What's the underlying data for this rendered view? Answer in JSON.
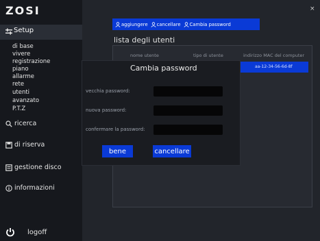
{
  "brand": "ZOSI",
  "sidebar": {
    "setup_label": "Setup",
    "sub_items": [
      "di base",
      "vivere",
      "registrazione",
      "piano",
      "allarme",
      "rete",
      "utenti",
      "avanzato",
      "P.T.Z"
    ],
    "ricerca": "ricerca",
    "di_riserva": "di riserva",
    "gestione_disco": "gestione disco",
    "informazioni": "informazioni",
    "logoff": "logoff"
  },
  "window": {
    "close": "×"
  },
  "toolbar": {
    "add": "aggiungere",
    "delete": "cancellare",
    "change_password": "Cambia password"
  },
  "user_list": {
    "title": "lista degli utenti",
    "columns": [
      "nome utente",
      "tipo di utente",
      "indirizzo MAC del computer"
    ],
    "selected_mac": "aa-12-34-56-6d-8f"
  },
  "dialog": {
    "title": "Cambia password",
    "old_label": "vecchia password:",
    "new_label": "nuova password:",
    "confirm_label": "confermare la password:",
    "old_value": "",
    "new_value": "",
    "confirm_value": "",
    "ok": "bene",
    "cancel": "cancellare"
  },
  "colors": {
    "accent": "#0a3ad6",
    "background": "#1b1e24",
    "sidebar": "#16181d"
  }
}
